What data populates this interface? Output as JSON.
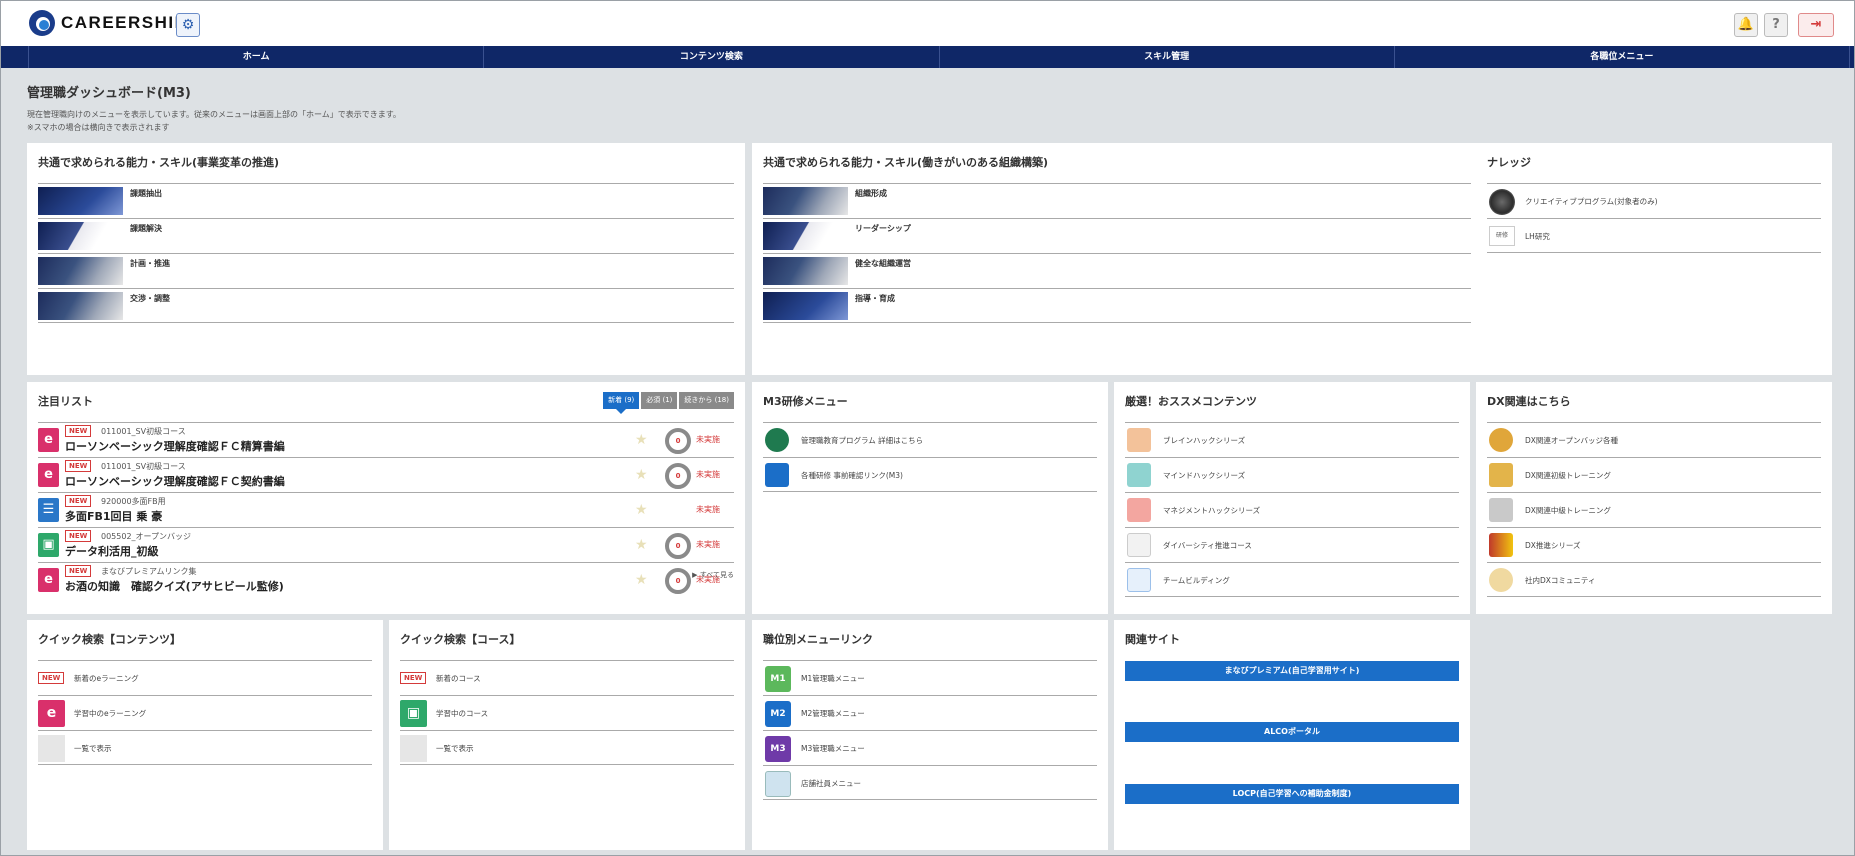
{
  "header": {
    "logo_text": "CAREERSHIP",
    "gear_icon": "⚙",
    "bell_icon": "🔔",
    "help_icon": "?",
    "logout_icon": "⇥"
  },
  "nav": {
    "items": [
      "ホーム",
      "コンテンツ検索",
      "スキル管理",
      "各職位メニュー"
    ]
  },
  "page": {
    "title": "管理職ダッシュボード(M3)",
    "desc_line1": "現在管理職向けのメニューを表示しています。従来のメニューは画面上部の「ホーム」で表示できます。",
    "desc_line2": "※スマホの場合は横向きで表示されます"
  },
  "skills1": {
    "title": "共通で求められる能力・スキル(事業変革の推進)",
    "items": [
      "課題抽出",
      "課題解決",
      "計画・推進",
      "交渉・調整"
    ]
  },
  "skills2": {
    "title": "共通で求められる能力・スキル(働きがいのある組織構築)",
    "items": [
      "組織形成",
      "リーダーシップ",
      "健全な組織運営",
      "指導・育成"
    ]
  },
  "knowledge": {
    "title": "ナレッジ",
    "items": [
      "クリエイティブプログラム(対象者のみ)",
      "LH研究"
    ],
    "icon2_text": "研修"
  },
  "attention": {
    "title": "注目リスト",
    "tabs": [
      "新着 (9)",
      "必須 (1)",
      "続きから (18)"
    ],
    "new_label": "NEW",
    "items": [
      {
        "code": "011001_SV初級コース",
        "title": "ローソンベーシック理解度確認ＦＣ精算書編",
        "ring": "0",
        "status": "未実施",
        "icon": "e"
      },
      {
        "code": "011001_SV初級コース",
        "title": "ローソンベーシック理解度確認ＦＣ契約書編",
        "ring": "0",
        "status": "未実施",
        "icon": "e"
      },
      {
        "code": "920000多面FB用",
        "title": "多面FB1回目 乗 豪",
        "status": "未実施",
        "icon": "☰"
      },
      {
        "code": "005502_オープンバッジ",
        "title": "データ利活用_初級",
        "ring": "0",
        "status": "未実施",
        "icon": "▣"
      },
      {
        "code": "まなびプレミアムリンク集",
        "title": "お酒の知識　確認クイズ(アサヒビール監修)",
        "ring": "0",
        "status": "未実施",
        "icon": "e"
      }
    ],
    "see_all": "▶ すべて見る"
  },
  "m3menu": {
    "title": "M3研修メニュー",
    "items": [
      "管理職教育プログラム 詳細はこちら",
      "各種研修 事前確認リンク(M3)"
    ]
  },
  "recommend": {
    "title": "厳選！おススメコンテンツ",
    "items": [
      "ブレインハックシリーズ",
      "マインドハックシリーズ",
      "マネジメントハックシリーズ",
      "ダイバーシティ推進コース",
      "チームビルディング"
    ]
  },
  "dx": {
    "title": "DX関連はこちら",
    "items": [
      "DX関連オープンバッジ各種",
      "DX関連初級トレーニング",
      "DX関連中級トレーニング",
      "DX推進シリーズ",
      "社内DXコミュニティ"
    ]
  },
  "quick_contents": {
    "title": "クイック検索【コンテンツ】",
    "new_label": "NEW",
    "items": [
      "新着のeラーニング",
      "学習中のeラーニング",
      "一覧で表示"
    ]
  },
  "quick_course": {
    "title": "クイック検索【コース】",
    "new_label": "NEW",
    "items": [
      "新着のコース",
      "学習中のコース",
      "一覧で表示"
    ]
  },
  "position_links": {
    "title": "職位別メニューリンク",
    "items": [
      {
        "badge": "M1",
        "label": "M1管理職メニュー"
      },
      {
        "badge": "M2",
        "label": "M2管理職メニュー"
      },
      {
        "badge": "M3",
        "label": "M3管理職メニュー"
      },
      {
        "badge": "",
        "label": "店舗社員メニュー"
      }
    ]
  },
  "related": {
    "title": "関連サイト",
    "links": [
      "まなびプレミアム(自己学習用サイト)",
      "ALCOポータル",
      "LOCP(自己学習への補助金制度)"
    ]
  },
  "colors": {
    "nav_bg": "#0f2767",
    "accent_blue": "#1b6ec8",
    "status_red": "#d43a3a"
  }
}
